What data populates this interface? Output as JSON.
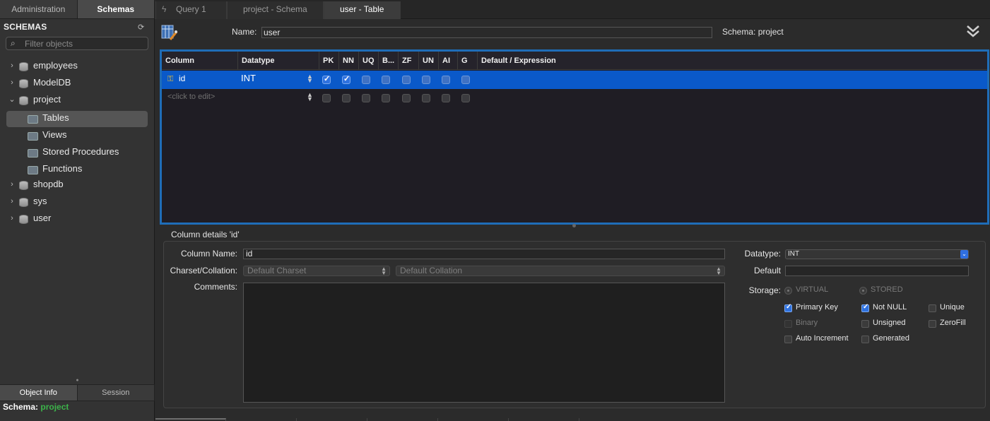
{
  "sidebar": {
    "tabs": [
      {
        "label": "Administration"
      },
      {
        "label": "Schemas"
      }
    ],
    "header": "SCHEMAS",
    "filter_placeholder": "Filter objects",
    "tree": [
      {
        "label": "employees"
      },
      {
        "label": "ModelDB"
      },
      {
        "label": "project"
      },
      {
        "label": "Tables"
      },
      {
        "label": "Views"
      },
      {
        "label": "Stored Procedures"
      },
      {
        "label": "Functions"
      },
      {
        "label": "shopdb"
      },
      {
        "label": "sys"
      },
      {
        "label": "user"
      }
    ],
    "bottom_tabs": [
      {
        "label": "Object Info"
      },
      {
        "label": "Session"
      }
    ],
    "schema_label": "Schema:",
    "schema_value": "project"
  },
  "tabs": [
    {
      "label": "Query 1"
    },
    {
      "label": "project - Schema"
    },
    {
      "label": "user - Table"
    }
  ],
  "editor": {
    "name_label": "Name:",
    "name_value": "user",
    "schema_label": "Schema:",
    "schema_value": "project"
  },
  "grid": {
    "headers": [
      "Column",
      "Datatype",
      "PK",
      "NN",
      "UQ",
      "B...",
      "ZF",
      "UN",
      "AI",
      "G",
      "Default / Expression"
    ],
    "rows": [
      {
        "column": "id",
        "datatype": "INT",
        "flags": [
          true,
          true,
          false,
          false,
          false,
          false,
          false,
          false
        ]
      },
      {
        "column": "<click to edit>",
        "datatype": "",
        "flags": [
          false,
          false,
          false,
          false,
          false,
          false,
          false,
          false
        ]
      }
    ]
  },
  "details": {
    "title": "Column details 'id'",
    "column_name_label": "Column Name:",
    "column_name_value": "id",
    "charset_label": "Charset/Collation:",
    "charset_value": "Default Charset",
    "collation_value": "Default Collation",
    "comments_label": "Comments:",
    "datatype_label": "Datatype:",
    "datatype_value": "INT",
    "default_label": "Default",
    "storage_label": "Storage:",
    "storage_virtual": "VIRTUAL",
    "storage_stored": "STORED",
    "options": {
      "primary_key": "Primary Key",
      "not_null": "Not NULL",
      "unique": "Unique",
      "binary": "Binary",
      "unsigned": "Unsigned",
      "zerofill": "ZeroFill",
      "auto_increment": "Auto Increment",
      "generated": "Generated"
    }
  },
  "colors": {
    "accent": "#0a59c9",
    "grid_border": "#1f6db8",
    "schema_green": "#3cb34a"
  }
}
